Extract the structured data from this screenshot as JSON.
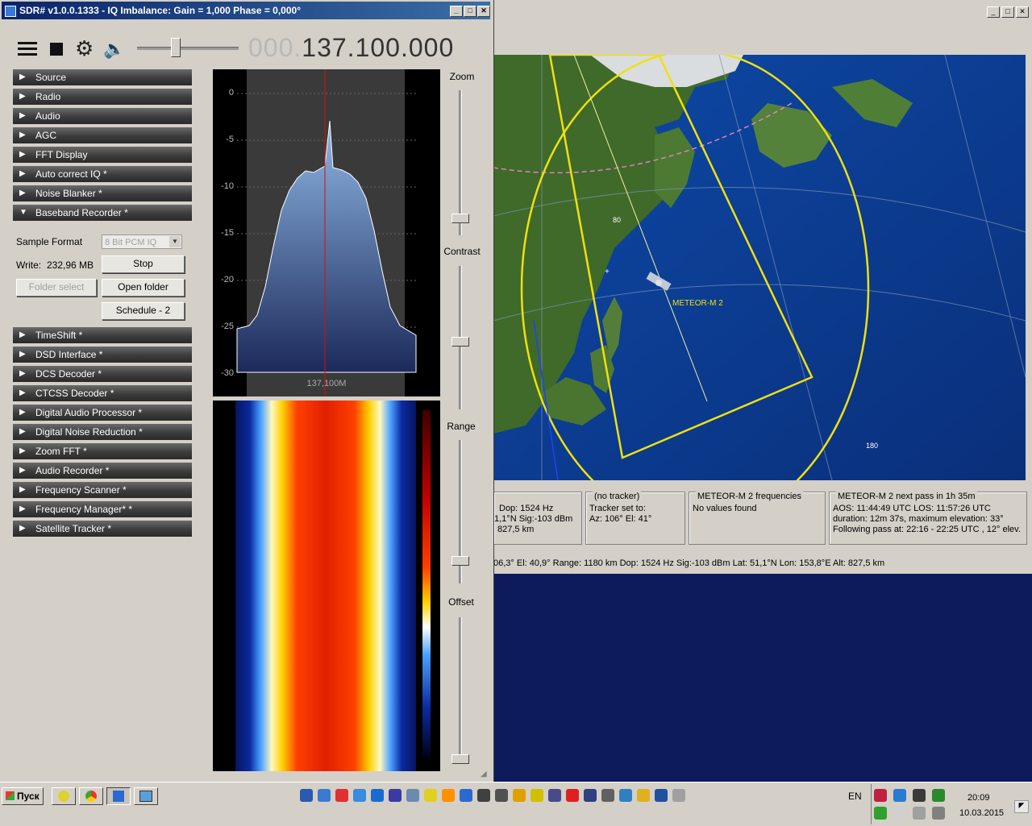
{
  "sdr": {
    "title": "SDR# v1.0.0.1333 - IQ Imbalance: Gain = 1,000 Phase = 0,000°",
    "freq_dim": "000.",
    "freq_main": "137.100.000",
    "panels_top": [
      "Source",
      "Radio",
      "Audio",
      "AGC",
      "FFT Display",
      "Auto correct IQ *",
      "Noise Blanker *",
      "Baseband Recorder *"
    ],
    "panels_bottom": [
      "TimeShift *",
      "DSD Interface *",
      "DCS Decoder *",
      "CTCSS Decoder *",
      "Digital Audio Processor *",
      "Digital Noise Reduction *",
      "Zoom FFT *",
      "Audio Recorder *",
      "Frequency Scanner *",
      "Frequency Manager* *",
      "Satellite Tracker *"
    ],
    "recorder": {
      "sample_format_label": "Sample Format",
      "sample_format_value": "8 Bit PCM IQ",
      "write_label": "Write:",
      "write_value": "232,96 MB",
      "stop": "Stop",
      "folder_select": "Folder select",
      "open_folder": "Open folder",
      "schedule": "Schedule - 2"
    },
    "spectrum": {
      "y_ticks": [
        "0",
        "-5",
        "-10",
        "-15",
        "-20",
        "-25",
        "-30"
      ],
      "center_label": "137,100M"
    },
    "sliders": {
      "zoom": "Zoom",
      "contrast": "Contrast",
      "range": "Range",
      "offset": "Offset"
    }
  },
  "orbitron": {
    "map_labels": {
      "sat": "METEOR-M 2",
      "grid_a": "80",
      "grid_b": "180"
    },
    "box1": {
      "line1": "Dop: 1524 Hz",
      "line2": "1,1°N  Sig:-103 dBm",
      "line3": "827,5 km"
    },
    "box2": {
      "header": "(no tracker)",
      "line1": "Tracker set to:",
      "line2": "Az: 106°  El: 41°"
    },
    "box3": {
      "header": "METEOR-M 2 frequencies",
      "line1": "No values found"
    },
    "box4": {
      "header": "METEOR-M 2 next pass in 1h 35m",
      "line1": "AOS: 11:44:49 UTC  LOS: 11:57:26 UTC",
      "line2": "duration: 12m 37s,  maximum elevation: 33°",
      "line3": "Following pass at: 22:16 - 22:25 UTC ,  12° elev."
    },
    "status": "06,3°  El: 40,9°  Range: 1180 km  Dop: 1524 Hz  Sig:-103 dBm  Lat: 51,1°N  Lon: 153,8°E  Alt: 827,5 km"
  },
  "taskbar": {
    "start": "Пуск",
    "lang": "EN",
    "time": "20:09",
    "date": "10.03.2015"
  }
}
